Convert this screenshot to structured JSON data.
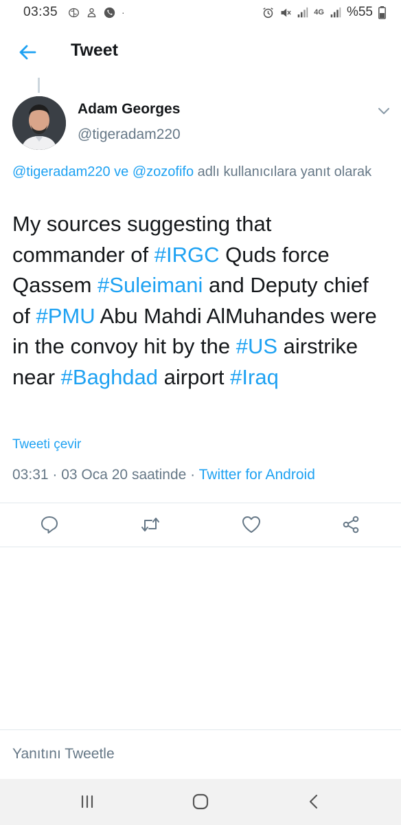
{
  "status_bar": {
    "time": "03:35",
    "network": "4G",
    "battery": "%55",
    "icons": [
      "brain-icon",
      "notification-icon",
      "phone-icon",
      "alarm-icon",
      "mute-icon",
      "signal-icon",
      "battery-icon"
    ]
  },
  "header": {
    "title": "Tweet",
    "back_icon": "back-arrow-icon"
  },
  "tweet": {
    "author_name": "Adam Georges",
    "author_handle": "@tigeradam220",
    "reply_mention_1": "@tigeradam220",
    "reply_connector": " ve ",
    "reply_mention_2": "@zozofifo",
    "reply_suffix": " adlı kullanıcılara yanıt olarak",
    "text_segments": [
      {
        "t": "My sources suggesting that commander of ",
        "tag": false
      },
      {
        "t": "#IRGC",
        "tag": true
      },
      {
        "t": " Quds force Qassem ",
        "tag": false
      },
      {
        "t": "#Suleimani",
        "tag": true
      },
      {
        "t": " and Deputy chief of ",
        "tag": false
      },
      {
        "t": "#PMU",
        "tag": true
      },
      {
        "t": " Abu Mahdi AlMuhandes were in the convoy hit by the ",
        "tag": false
      },
      {
        "t": "#US",
        "tag": true
      },
      {
        "t": " airstrike near ",
        "tag": false
      },
      {
        "t": "#Baghdad",
        "tag": true
      },
      {
        "t": " airport ",
        "tag": false
      },
      {
        "t": "#Iraq",
        "tag": true
      }
    ],
    "translate_label": "Tweeti çevir",
    "timestamp": "03:31 · 03 Oca 20 saatinde · ",
    "source": "Twitter for Android"
  },
  "actions": [
    {
      "name": "reply-button",
      "icon": "reply-icon"
    },
    {
      "name": "retweet-button",
      "icon": "retweet-icon"
    },
    {
      "name": "like-button",
      "icon": "heart-icon"
    },
    {
      "name": "share-button",
      "icon": "share-icon"
    }
  ],
  "reply_box": {
    "placeholder": "Yanıtını Tweetle"
  },
  "nav": {
    "icons": [
      "recent-apps-icon",
      "home-icon",
      "back-icon"
    ]
  },
  "colors": {
    "accent": "#1da1f2",
    "text": "#14171a",
    "secondary": "#657786",
    "divider": "#e1e8ed"
  }
}
